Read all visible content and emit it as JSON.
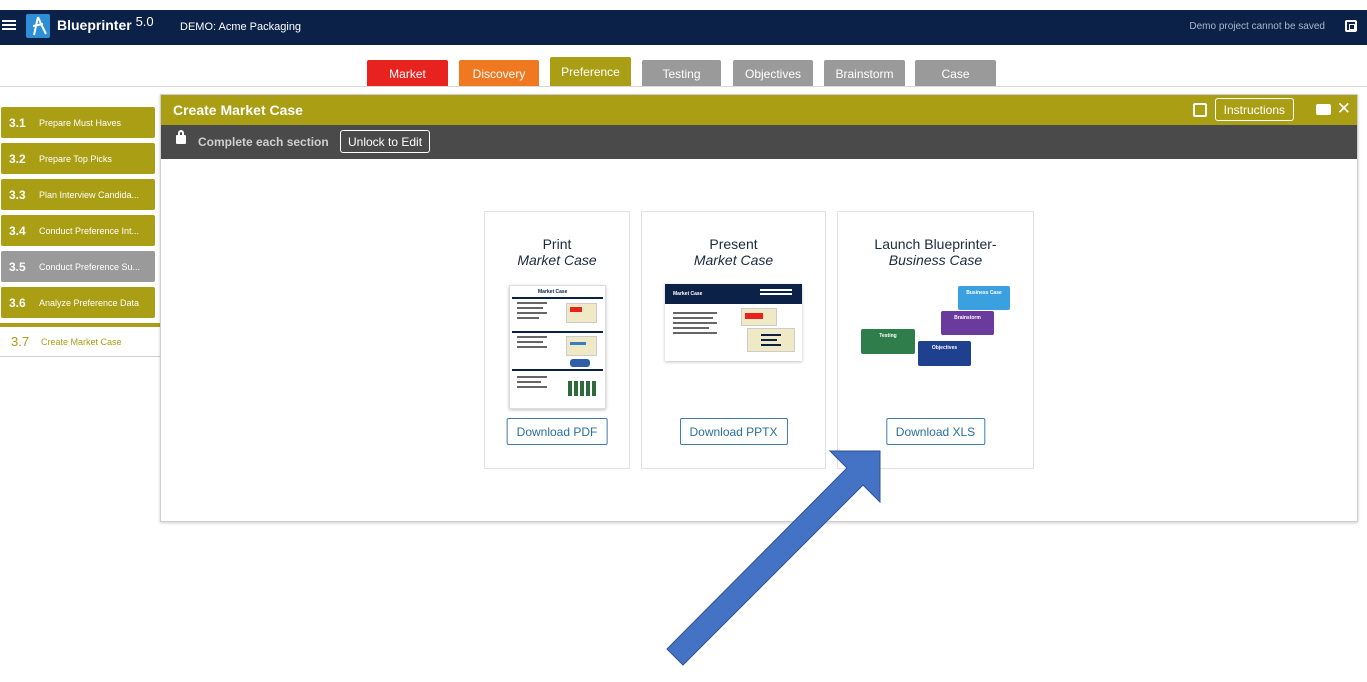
{
  "header": {
    "brand": "Blueprinter",
    "version": "5.0",
    "project": "DEMO: Acme Packaging",
    "notice": "Demo project cannot be saved"
  },
  "tabs": [
    {
      "label": "Market",
      "color": "#e8231f"
    },
    {
      "label": "Discovery",
      "color": "#f07820"
    },
    {
      "label": "Preference",
      "color": "#aa9e14"
    },
    {
      "label": "Testing",
      "color": "#9a9a9a"
    },
    {
      "label": "Objectives",
      "color": "#9a9a9a"
    },
    {
      "label": "Brainstorm",
      "color": "#9a9a9a"
    },
    {
      "label": "Case",
      "color": "#9a9a9a"
    }
  ],
  "active_tab": "Preference",
  "sidebar": {
    "items": [
      {
        "num": "3.1",
        "label": "Prepare Must Haves",
        "color": "#aa9e14"
      },
      {
        "num": "3.2",
        "label": "Prepare Top Picks",
        "color": "#aa9e14"
      },
      {
        "num": "3.3",
        "label": "Plan Interview Candida...",
        "color": "#aa9e14"
      },
      {
        "num": "3.4",
        "label": "Conduct Preference Int...",
        "color": "#aa9e14"
      },
      {
        "num": "3.5",
        "label": "Conduct Preference Su...",
        "color": "#9a9a9a"
      },
      {
        "num": "3.6",
        "label": "Analyze Preference Data",
        "color": "#aa9e14"
      },
      {
        "num": "3.7",
        "label": "Create Market Case",
        "color": "#aa9e14"
      }
    ]
  },
  "panel": {
    "title": "Create Market Case",
    "instructions": "Instructions",
    "lock_message": "Complete each section",
    "unlock_label": "Unlock to Edit"
  },
  "cards": [
    {
      "line1": "Print",
      "line2": "Market Case",
      "button": "Download PDF",
      "thumb_title": "Market Case"
    },
    {
      "line1": "Present",
      "line2": "Market Case",
      "button": "Download PPTX",
      "thumb_title": "Market Case"
    },
    {
      "line1": "Launch Blueprinter-",
      "line2": "Business Case",
      "button": "Download XLS",
      "tiles": [
        {
          "label": "Business Case",
          "color": "#3aa0e0"
        },
        {
          "label": "Brainstorm",
          "color": "#6a3a9c"
        },
        {
          "label": "Testing",
          "color": "#2f7d4a"
        },
        {
          "label": "Objectives",
          "color": "#1f3f8f"
        }
      ]
    }
  ],
  "annotation": {
    "arrow_color": "#4472c4"
  }
}
